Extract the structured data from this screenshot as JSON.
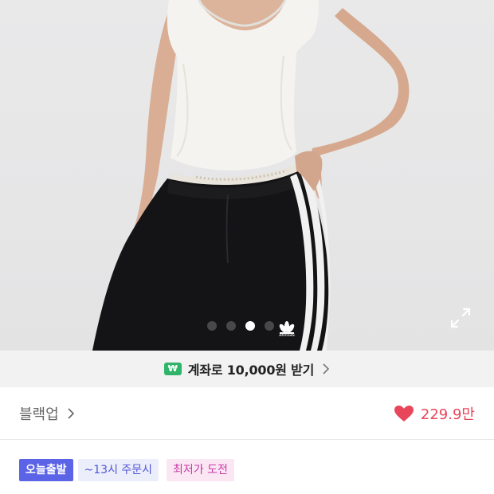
{
  "hero": {
    "brand_mark": "adidas",
    "carousel": {
      "total": 4,
      "active_index": 2
    },
    "icons": {
      "expand": "expand-icon"
    }
  },
  "promo": {
    "icon": "won",
    "text": "계좌로 10,000원 받기"
  },
  "product": {
    "variant_label": "블랙업",
    "likes": "229.9만"
  },
  "badges": {
    "today": "오늘출발",
    "cutoff": "~13시 주문시",
    "lowest": "최저가 도전"
  },
  "colors": {
    "accent_heart": "#e8465b",
    "today_badge": "#5b63e6",
    "won_badge": "#2fb46a"
  }
}
